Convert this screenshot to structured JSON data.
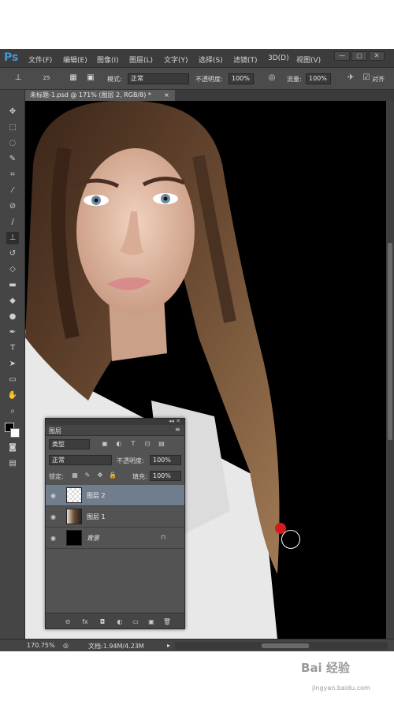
{
  "app": {
    "logo": "Ps"
  },
  "menu": [
    "文件(F)",
    "编辑(E)",
    "图像(I)",
    "图层(L)",
    "文字(Y)",
    "选择(S)",
    "滤镜(T)",
    "3D(D)",
    "视图(V)"
  ],
  "window_buttons": [
    "—",
    "▢",
    "✕"
  ],
  "options": {
    "brush_size": "25",
    "mode_label": "模式:",
    "mode_value": "正常",
    "opacity_label": "不透明度:",
    "opacity_value": "100%",
    "flow_label": "流量:",
    "flow_value": "100%",
    "align_label": "对齐"
  },
  "document_tab": {
    "title": "未标题-1.psd @ 171% (图层 2, RGB/8) *",
    "close": "×"
  },
  "status": {
    "zoom": "170.75%",
    "doc": "文档:1.94M/4.23M"
  },
  "layers_panel": {
    "title": "图层",
    "filter": "类型",
    "blend_mode": "正常",
    "opacity_label": "不透明度:",
    "opacity_value": "100%",
    "lock_label": "锁定:",
    "fill_label": "填充:",
    "fill_value": "100%",
    "layers": [
      {
        "name": "图层 2",
        "active": true
      },
      {
        "name": "图层 1",
        "active": false
      },
      {
        "name": "背景",
        "active": false
      }
    ],
    "bottom_icons": [
      "⊝",
      "fx",
      "◘",
      "◐",
      "▭",
      "▣",
      "🗑"
    ]
  },
  "watermark": {
    "brand": "Bai  经验",
    "url": "jingyan.baidu.com"
  },
  "colors": {
    "accent": "#3e9ad8",
    "active_layer": "#6f7d8c",
    "brush_dot": "#d31b1b"
  }
}
